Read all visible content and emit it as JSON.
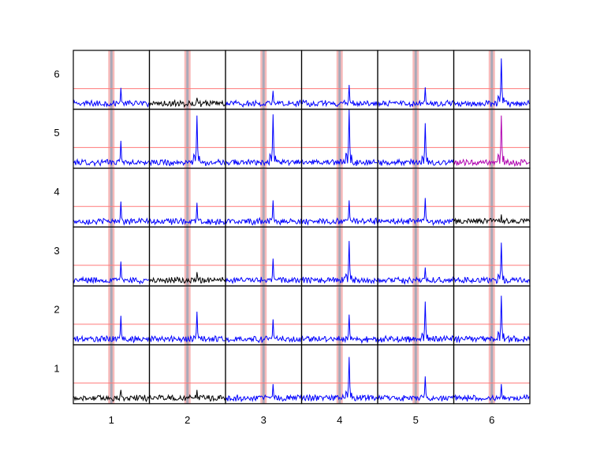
{
  "chart_data": {
    "type": "line",
    "layout": "6x6 grid of small multiples",
    "title": "",
    "xlabel": "",
    "ylabel": "",
    "column_labels": [
      "1",
      "2",
      "3",
      "4",
      "5",
      "6"
    ],
    "row_labels": [
      "6",
      "5",
      "4",
      "3",
      "2",
      "1"
    ],
    "grid": false,
    "threshold_line": {
      "level": 0.35,
      "color": "#ff7a7a"
    },
    "marker_band": {
      "center": 0.5,
      "colors": [
        "#f4a3a3",
        "#a9a9b8"
      ]
    },
    "series_colors": {
      "default": "#0000ff",
      "black": "#000000",
      "magenta": "#b000b0"
    },
    "cells": [
      [
        {
          "peak": 0.35,
          "color": "blue"
        },
        {
          "peak": 0.18,
          "color": "black"
        },
        {
          "peak": 0.3,
          "color": "blue"
        },
        {
          "peak": 0.4,
          "color": "blue"
        },
        {
          "peak": 0.36,
          "color": "blue"
        },
        {
          "peak": 0.85,
          "color": "blue"
        }
      ],
      [
        {
          "peak": 0.45,
          "color": "blue"
        },
        {
          "peak": 0.88,
          "color": "blue"
        },
        {
          "peak": 0.9,
          "color": "blue"
        },
        {
          "peak": 0.98,
          "color": "blue"
        },
        {
          "peak": 0.75,
          "color": "blue"
        },
        {
          "peak": 0.88,
          "color": "magenta"
        }
      ],
      [
        {
          "peak": 0.42,
          "color": "blue"
        },
        {
          "peak": 0.4,
          "color": "blue"
        },
        {
          "peak": 0.44,
          "color": "blue"
        },
        {
          "peak": 0.44,
          "color": "blue"
        },
        {
          "peak": 0.48,
          "color": "blue"
        },
        {
          "peak": 0.2,
          "color": "black"
        }
      ],
      [
        {
          "peak": 0.4,
          "color": "blue"
        },
        {
          "peak": 0.22,
          "color": "black"
        },
        {
          "peak": 0.45,
          "color": "blue"
        },
        {
          "peak": 0.75,
          "color": "blue"
        },
        {
          "peak": 0.3,
          "color": "blue"
        },
        {
          "peak": 0.72,
          "color": "blue"
        }
      ],
      [
        {
          "peak": 0.48,
          "color": "blue"
        },
        {
          "peak": 0.55,
          "color": "blue"
        },
        {
          "peak": 0.42,
          "color": "blue"
        },
        {
          "peak": 0.5,
          "color": "blue"
        },
        {
          "peak": 0.72,
          "color": "blue"
        },
        {
          "peak": 0.82,
          "color": "blue"
        }
      ],
      [
        {
          "peak": 0.22,
          "color": "black"
        },
        {
          "peak": 0.22,
          "color": "black"
        },
        {
          "peak": 0.32,
          "color": "blue"
        },
        {
          "peak": 0.78,
          "color": "blue"
        },
        {
          "peak": 0.45,
          "color": "blue"
        },
        {
          "peak": 0.32,
          "color": "blue"
        }
      ]
    ]
  }
}
